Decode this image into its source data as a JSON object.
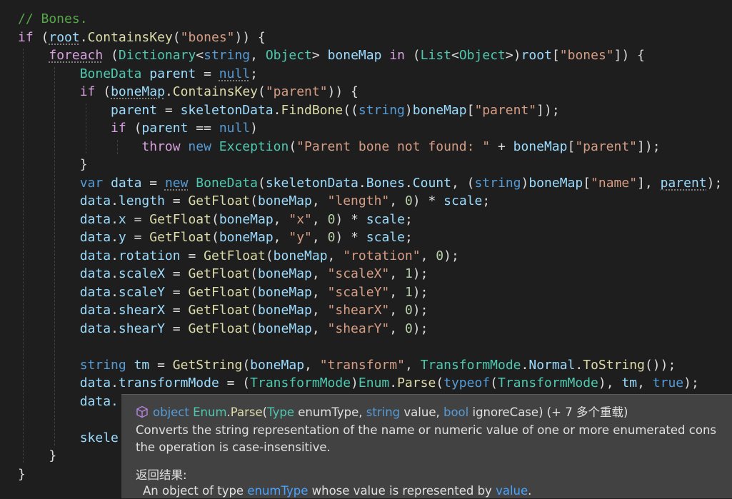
{
  "code": {
    "comment": "// Bones.",
    "root_var": "root",
    "contains_key": "ContainsKey",
    "bones_key": "\"bones\"",
    "bonemap_var": "boneMap",
    "dictionary_type": "Dictionary",
    "string_kw": "string",
    "object_type": "Object",
    "in_kw": "in",
    "list_type": "List",
    "bone_data_type": "BoneData",
    "parent_var": "parent",
    "null_kw": "null",
    "parent_key": "\"parent\"",
    "skeleton_data": "skeletonData",
    "find_bone": "FindBone",
    "throw_kw": "throw",
    "new_kw": "new",
    "exception_type": "Exception",
    "parent_not_found": "\"Parent bone not found: \"",
    "var_kw": "var",
    "data_var": "data",
    "bones_prop": "Bones",
    "count_prop": "Count",
    "name_key": "\"name\"",
    "get_float": "GetFloat",
    "get_string": "GetString",
    "scale_var": "scale",
    "zero": "0",
    "one": "1",
    "length_prop": "length",
    "x_prop": "x",
    "y_prop": "y",
    "rotation_prop": "rotation",
    "scalex_prop": "scaleX",
    "scaley_prop": "scaleY",
    "shearx_prop": "shearX",
    "sheary_prop": "shearY",
    "length_key": "\"length\"",
    "x_key": "\"x\"",
    "y_key": "\"y\"",
    "rotation_key": "\"rotation\"",
    "scalex_key": "\"scaleX\"",
    "scaley_key": "\"scaleY\"",
    "shearx_key": "\"shearX\"",
    "sheary_key": "\"shearY\"",
    "tm_var": "tm",
    "transform_key": "\"transform\"",
    "transform_mode_type": "TransformMode",
    "normal_member": "Normal",
    "to_string": "ToString",
    "transform_mode_prop": "transformMode",
    "enum_type": "Enum",
    "parse_fn": "Parse",
    "typeof_kw": "typeof",
    "true_kw": "true",
    "partial_data": "data.",
    "partial_skele": "skele"
  },
  "tooltip": {
    "icon": "cube-icon",
    "sig_object": "object",
    "sig_enum": "Enum",
    "sig_parse": "Parse",
    "sig_type_kw": "Type",
    "sig_p1": "enumType",
    "sig_string_kw": "string",
    "sig_p2": "value",
    "sig_bool_kw": "bool",
    "sig_p3": "ignoreCase",
    "sig_overloads": "(+ 7 多个重载)",
    "desc_line1": "Converts the string representation of the name or numeric value of one or more enumerated cons",
    "desc_line2": "the operation is case-insensitive.",
    "returns_label": "返回结果:",
    "returns_pre": "An object of type ",
    "returns_link1": "enumType",
    "returns_mid": " whose value is represented by ",
    "returns_link2": "value",
    "returns_post": "."
  }
}
